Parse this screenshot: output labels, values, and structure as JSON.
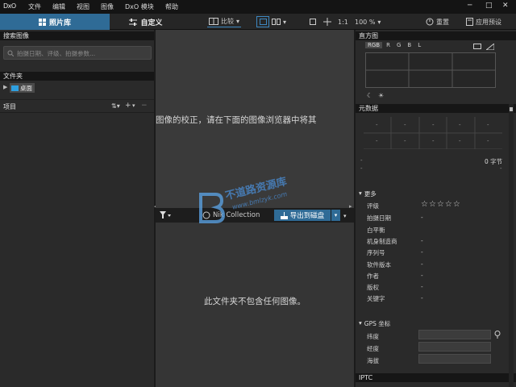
{
  "menubar": {
    "logo": "DxO",
    "items": [
      "文件",
      "编辑",
      "视图",
      "图像",
      "DxO 模块",
      "帮助"
    ],
    "window_controls": [
      "─",
      "□",
      "✕"
    ]
  },
  "toolbar": {
    "tab_library": "照片库",
    "tab_customize": "自定义",
    "compare_label": "比较",
    "zoom_ratio": "1:1",
    "zoom_percent": "100 %",
    "reset_label": "重置",
    "apply_preset_label": "应用预设"
  },
  "left_panel": {
    "search_header": "搜索图像",
    "search_placeholder": "拍摄日期、评级、拍摄参数...",
    "folders_header": "文件夹",
    "folder_desktop": "桌面",
    "projects_header": "项目",
    "add_label": "+",
    "minus_label": "−"
  },
  "center": {
    "hint_text": "图像的校正，请在下面的图像浏览器中将其",
    "nik_label": "Nik Collection",
    "export_label": "导出到磁盘",
    "empty_text": "此文件夹不包含任何图像。",
    "watermark": "不道路资源库",
    "watermark_url": "www.bmlzyk.com"
  },
  "right_panel": {
    "histogram_header": "直方图",
    "channels": [
      "RGB",
      "R",
      "G",
      "B",
      "L"
    ],
    "metadata_header": "元数据",
    "dash": "-",
    "file_size": "0 字节",
    "more_header": "更多",
    "fields": [
      {
        "label": "评级",
        "value": "☆☆☆☆☆"
      },
      {
        "label": "拍摄日期",
        "value": "-"
      },
      {
        "label": "白平衡",
        "value": ""
      },
      {
        "label": "机身制造商",
        "value": "-"
      },
      {
        "label": "序列号",
        "value": "-"
      },
      {
        "label": "软件版本",
        "value": "-"
      },
      {
        "label": "作者",
        "value": "-"
      },
      {
        "label": "版权",
        "value": "-"
      },
      {
        "label": "关键字",
        "value": "-"
      }
    ],
    "gps_header": "GPS 坐标",
    "gps_fields": [
      "纬度",
      "经度",
      "海拔"
    ],
    "iptc_header": "IPTC"
  }
}
